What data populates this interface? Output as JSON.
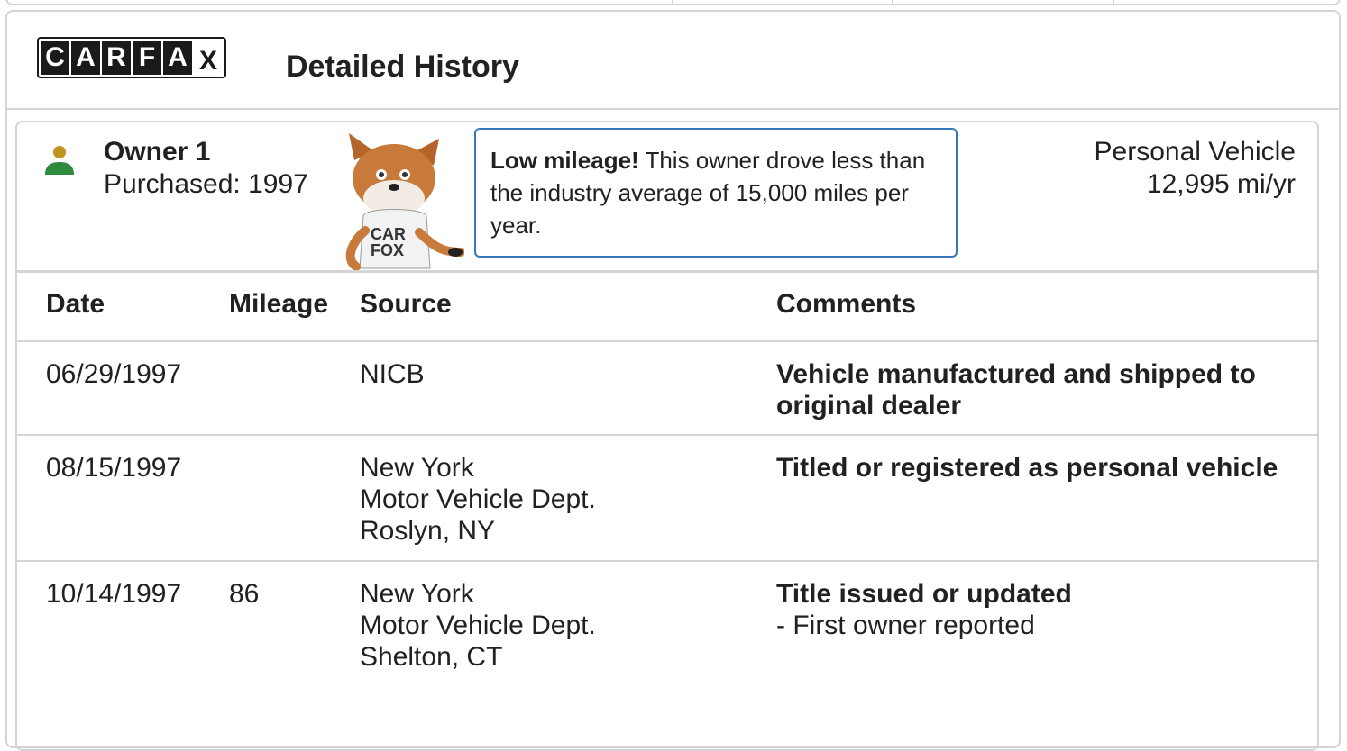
{
  "header": {
    "title": "Detailed History"
  },
  "logo": {
    "letters": [
      "C",
      "A",
      "R",
      "F",
      "A"
    ],
    "last": "X"
  },
  "owner": {
    "name": "Owner 1",
    "purchased": "Purchased: 1997",
    "callout_bold": "Low mileage!",
    "callout_text": " This owner drove less than the industry average of 15,000 miles per year.",
    "vehicle_type": "Personal Vehicle",
    "mileage_per_year": "12,995 mi/yr"
  },
  "table": {
    "headers": [
      "Date",
      "Mileage",
      "Source",
      "Comments"
    ],
    "rows": [
      {
        "date": "06/29/1997",
        "mileage": "",
        "source": [
          "NICB"
        ],
        "comment_title": "Vehicle manufactured and shipped to original dealer",
        "comment_detail": ""
      },
      {
        "date": "08/15/1997",
        "mileage": "",
        "source": [
          "New York",
          "Motor Vehicle Dept.",
          "Roslyn, NY"
        ],
        "comment_title": "Titled or registered as personal vehicle",
        "comment_detail": ""
      },
      {
        "date": "10/14/1997",
        "mileage": "86",
        "source": [
          "New York",
          "Motor Vehicle Dept.",
          "Shelton, CT"
        ],
        "comment_title": "Title issued or updated",
        "comment_detail": "- First owner reported"
      }
    ]
  },
  "colors": {
    "accent": "#3777bc",
    "owner_head": "#c0951f",
    "owner_body": "#2e8b3e",
    "border": "#d4d4d4"
  },
  "icons": {
    "owner": "person-icon",
    "mascot": "carfox-mascot"
  }
}
